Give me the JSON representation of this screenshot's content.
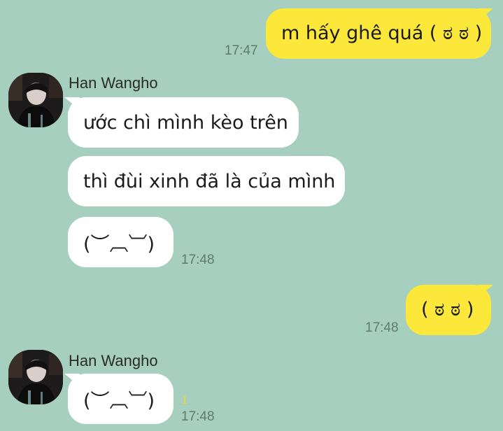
{
  "chat": {
    "messages": [
      {
        "direction": "out",
        "text": "m hấy ghê quá ( ಠ ಠ )",
        "time": "17:47"
      },
      {
        "direction": "in",
        "sender": "Han Wangho",
        "text": "ước chì mình kèo trên"
      },
      {
        "direction": "in",
        "text": "thì đùi xinh đã là của mình"
      },
      {
        "direction": "in",
        "text": "(︶︹︺)",
        "time": "17:48"
      },
      {
        "direction": "out",
        "text": "( ಠ ಠ )",
        "time": "17:48"
      },
      {
        "direction": "in",
        "sender": "Han Wangho",
        "text": "(︶︹︺)",
        "time": "17:48",
        "unread": "1"
      }
    ]
  },
  "colors": {
    "background": "#a6cfc0",
    "outgoing_bubble": "#fbe83a",
    "incoming_bubble": "#ffffff",
    "timestamp": "#5f7a70",
    "unread": "#f2d43a"
  }
}
